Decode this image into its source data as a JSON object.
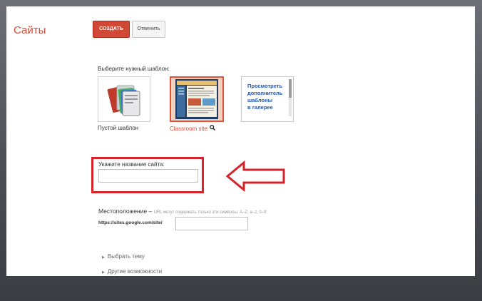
{
  "app": {
    "title": "Сайты"
  },
  "toolbar": {
    "create_label": "СОЗДАТЬ",
    "cancel_label": "Отменить"
  },
  "templates": {
    "heading": "Выберите нужный шаблон:",
    "items": [
      {
        "label": "Пустой шаблон",
        "icon": "document-stack-icon"
      },
      {
        "label": "Classroom site",
        "icon": "site-thumbnail"
      },
      {
        "label": "Просмотреть дополнитель шаблоны в галерее",
        "lines": [
          "Просмотреть",
          "дополнитель",
          "шаблоны",
          "в галерее"
        ]
      }
    ],
    "search_icon": "magnifier-icon"
  },
  "site_name": {
    "label": "Укажите название сайта:",
    "value": "",
    "placeholder": ""
  },
  "location": {
    "label": "Местоположение –",
    "hint": "URL могут содержать только эти символы: A–Z, a–z, 0–9",
    "url_prefix": "https://sites.google.com/site/",
    "value": ""
  },
  "expanders": [
    "Выбрать тему",
    "Другие возможности"
  ],
  "colors": {
    "accent": "#dd4b39",
    "button": "#d14836",
    "highlight": "#d9222a"
  }
}
